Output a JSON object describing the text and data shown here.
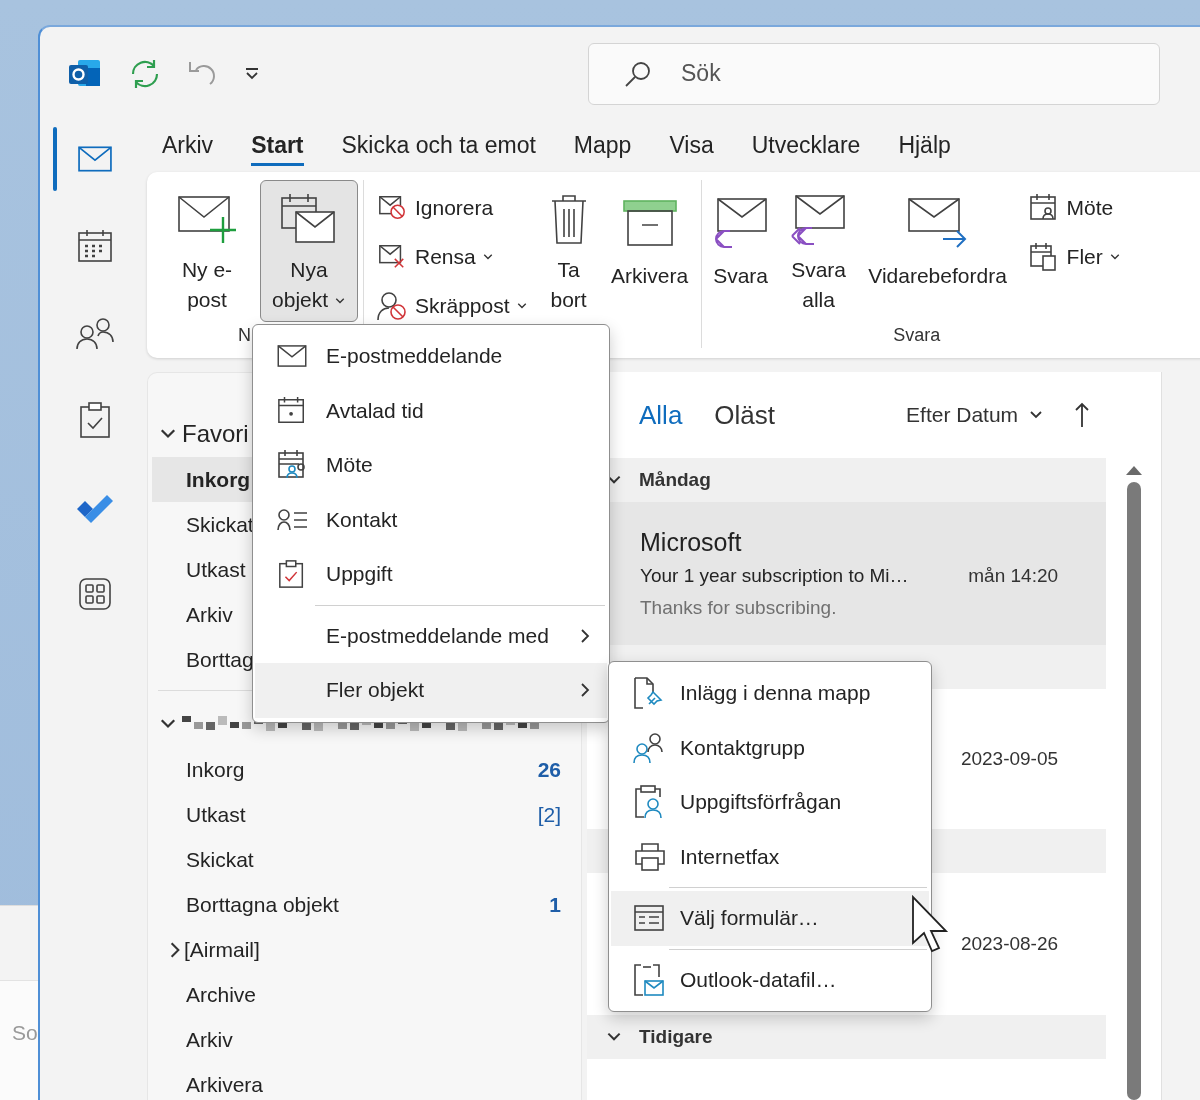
{
  "desktop": {
    "fragment_text": "So"
  },
  "search": {
    "placeholder": "Sök"
  },
  "menu_tabs": [
    {
      "label": "Arkiv",
      "selected": false
    },
    {
      "label": "Start",
      "selected": true
    },
    {
      "label": "Skicka och ta emot",
      "selected": false
    },
    {
      "label": "Mapp",
      "selected": false
    },
    {
      "label": "Visa",
      "selected": false
    },
    {
      "label": "Utvecklare",
      "selected": false
    },
    {
      "label": "Hjälp",
      "selected": false
    }
  ],
  "ribbon": {
    "groups": [
      {
        "label": "N",
        "items": [
          {
            "kind": "large",
            "label": "Ny e-post",
            "pressed": false,
            "dropdown": false
          },
          {
            "kind": "large",
            "label": "Nya objekt",
            "pressed": true,
            "dropdown": true
          }
        ]
      },
      {
        "items": [
          {
            "kind": "stack",
            "buttons": [
              {
                "label": "Ignorera",
                "dropdown": false
              },
              {
                "label": "Rensa",
                "dropdown": true
              },
              {
                "label": "Skräppost",
                "dropdown": true
              }
            ]
          },
          {
            "kind": "large",
            "label": "Ta bort",
            "pressed": false,
            "dropdown": false
          },
          {
            "kind": "large",
            "label": "Arkivera",
            "pressed": false,
            "dropdown": false
          }
        ]
      },
      {
        "label": "Svara",
        "items": [
          {
            "kind": "large",
            "label": "Svara",
            "pressed": false,
            "dropdown": false
          },
          {
            "kind": "large",
            "label": "Svara alla",
            "pressed": false,
            "dropdown": false
          },
          {
            "kind": "large",
            "label": "Vidarebefordra",
            "pressed": false,
            "dropdown": false
          },
          {
            "kind": "stack",
            "buttons": [
              {
                "label": "Möte",
                "dropdown": false
              },
              {
                "label": "Fler",
                "dropdown": true
              }
            ]
          }
        ]
      }
    ]
  },
  "nav": [
    {
      "selected": true
    },
    {
      "selected": false
    },
    {
      "selected": false
    },
    {
      "selected": false
    },
    {
      "selected": false
    },
    {
      "selected": false
    }
  ],
  "folder_pane": {
    "favorites": {
      "label": "Favori",
      "expanded": true,
      "items": [
        {
          "label": "Inkorg",
          "selected": true
        },
        {
          "label": "Skickat",
          "selected": false
        },
        {
          "label": "Utkast",
          "selected": false
        },
        {
          "label": "Arkiv",
          "selected": false
        },
        {
          "label": "Borttag",
          "selected": false
        }
      ]
    },
    "account": {
      "expanded": true,
      "folders": [
        {
          "label": "Inkorg",
          "count": "26",
          "count_bold": true,
          "expandable": false
        },
        {
          "label": "Utkast",
          "count": "[2]",
          "count_bold": false,
          "expandable": false
        },
        {
          "label": "Skickat",
          "expandable": false
        },
        {
          "label": "Borttagna objekt",
          "count": "1",
          "count_bold": true,
          "expandable": false
        },
        {
          "label": "[Airmail]",
          "expandable": true
        },
        {
          "label": "Archive",
          "expandable": false
        },
        {
          "label": "Arkiv",
          "expandable": false
        },
        {
          "label": "Arkivera",
          "expandable": false
        }
      ]
    }
  },
  "message_list": {
    "filters": [
      {
        "label": "Alla",
        "selected": true
      },
      {
        "label": "Oläst",
        "selected": false
      }
    ],
    "sort": {
      "label": "Efter Datum"
    },
    "items": [
      {
        "kind": "header",
        "label": "Måndag"
      },
      {
        "kind": "message",
        "sender": "Microsoft",
        "subject": "Your 1 year subscription to Mi…",
        "time": "mån 14:20",
        "preview": "Thanks for subscribing.",
        "selected": true
      },
      {
        "kind": "header"
      },
      {
        "kind": "message",
        "time": "2023-09-05",
        "selected": false
      },
      {
        "kind": "header"
      },
      {
        "kind": "message",
        "time": "2023-08-26",
        "selected": false
      },
      {
        "kind": "header",
        "label": "Tidigare"
      }
    ]
  },
  "new_items_menu": {
    "items": [
      {
        "kind": "item",
        "label": "E-postmeddelande",
        "highlighted": false
      },
      {
        "kind": "item",
        "label": "Avtalad tid",
        "highlighted": false
      },
      {
        "kind": "item",
        "label": "Möte",
        "highlighted": false
      },
      {
        "kind": "item",
        "label": "Kontakt",
        "highlighted": false
      },
      {
        "kind": "item",
        "label": "Uppgift",
        "highlighted": false
      },
      {
        "kind": "separator"
      },
      {
        "kind": "submenu",
        "label": "E-postmeddelande med",
        "highlighted": false
      },
      {
        "kind": "submenu",
        "label": "Fler objekt",
        "highlighted": true
      }
    ]
  },
  "more_items_menu": {
    "items": [
      {
        "kind": "item",
        "label": "Inlägg i denna mapp",
        "highlighted": false
      },
      {
        "kind": "item",
        "label": "Kontaktgrupp",
        "highlighted": false
      },
      {
        "kind": "item",
        "label": "Uppgiftsförfrågan",
        "highlighted": false
      },
      {
        "kind": "item",
        "label": "Internetfax",
        "highlighted": false
      },
      {
        "kind": "separator"
      },
      {
        "kind": "item",
        "label": "Välj formulär…",
        "highlighted": true
      },
      {
        "kind": "separator"
      },
      {
        "kind": "item",
        "label": "Outlook-datafil…",
        "highlighted": false
      }
    ]
  }
}
